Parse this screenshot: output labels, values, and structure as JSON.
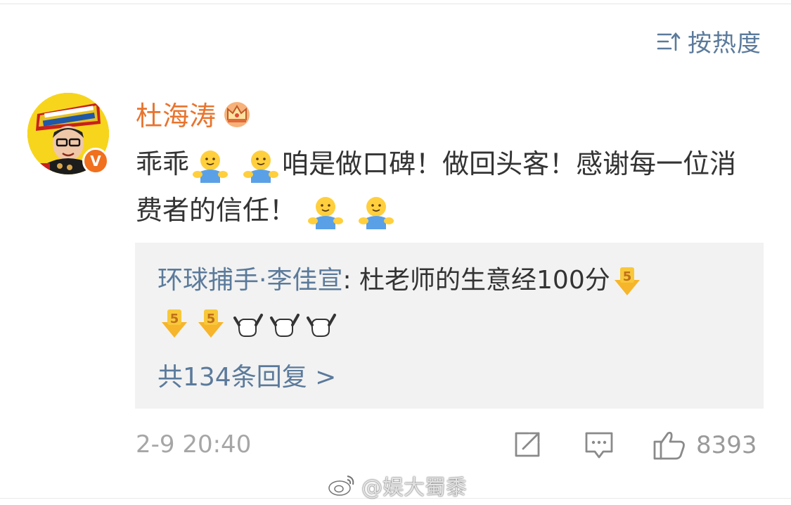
{
  "sort": {
    "label": "按热度",
    "icon": "sort-icon"
  },
  "comment": {
    "username": "杜海涛",
    "avatar_badge": "V",
    "text_parts": [
      "乖乖",
      "咱是做口碑！做回头客！感谢每一位消费者的信任！"
    ],
    "timestamp": "2-9 20:40"
  },
  "reply": {
    "author": "环球捕手·李佳宣",
    "separator": ": ",
    "text": "杜老师的生意经100分",
    "more_label": "共134条回复 >"
  },
  "actions": {
    "like_count": "8393"
  },
  "watermark": {
    "text": "@娱大蜀黍"
  },
  "colors": {
    "link_blue": "#5b7a9b",
    "username_orange": "#e8742e",
    "reply_bg": "#f2f2f2",
    "timestamp_gray": "#a6a6a6"
  }
}
